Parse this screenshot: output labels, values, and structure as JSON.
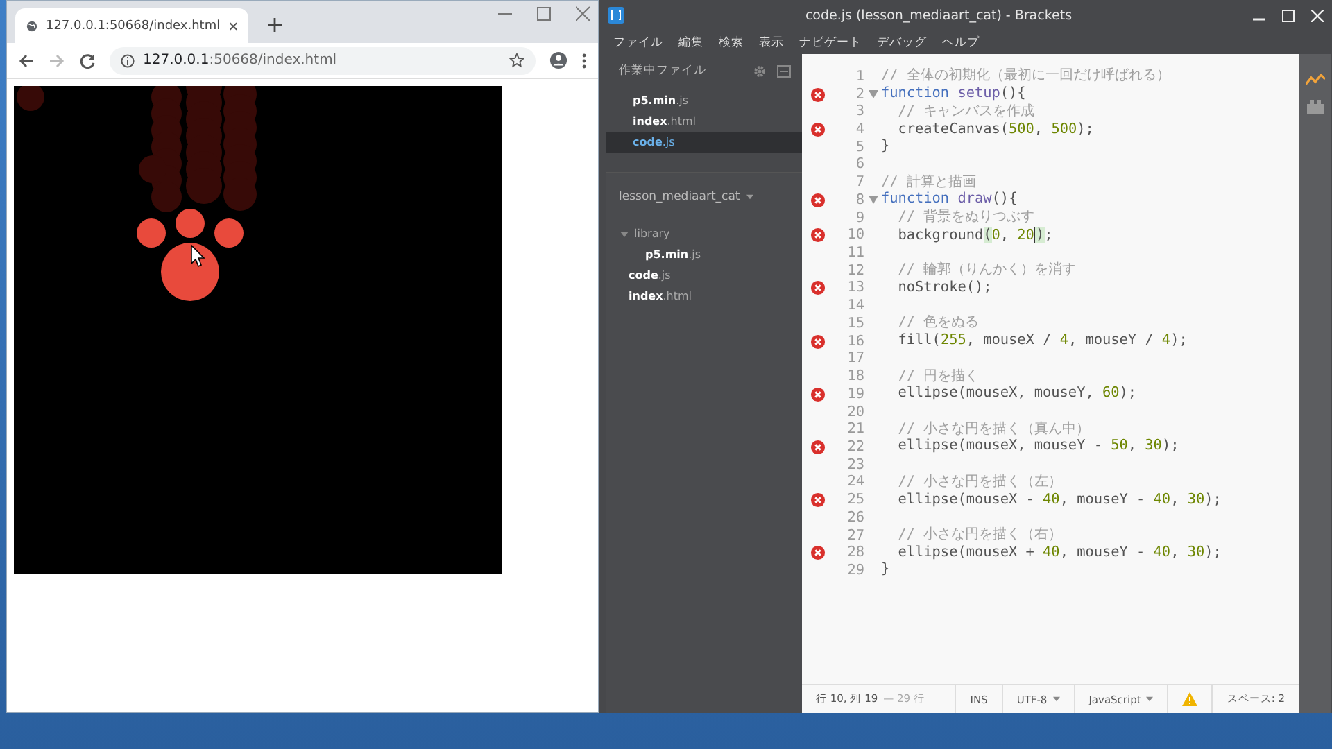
{
  "browser": {
    "tab_title": "127.0.0.1:50668/index.html",
    "address": {
      "host": "127.0.0.1",
      "path": ":50668/index.html"
    }
  },
  "editor": {
    "title": "code.js (lesson_mediaart_cat) - Brackets",
    "menu": [
      "ファイル",
      "編集",
      "検索",
      "表示",
      "ナビゲート",
      "デバッグ",
      "ヘルプ"
    ],
    "working_files": {
      "title": "作業中ファイル",
      "items": [
        {
          "name": "**p5.min**.js",
          "selected": false
        },
        {
          "name": "**index**.html",
          "selected": false
        },
        {
          "name": "**code**.js",
          "selected": true
        }
      ]
    },
    "project": {
      "name": "lesson_mediaart_cat",
      "tree": [
        {
          "kind": "folder",
          "name": "library",
          "expanded": true,
          "children": [
            {
              "kind": "file",
              "name": "**p5.min**.js"
            }
          ]
        },
        {
          "kind": "file",
          "name": "**code**.js"
        },
        {
          "kind": "file",
          "name": "**index**.html"
        }
      ]
    },
    "lines": [
      {
        "n": "1",
        "error": false,
        "fold": false,
        "tokens": [
          {
            "kind": "comment",
            "text": "// 全体の初期化（最初に一回だけ呼ばれる）"
          }
        ]
      },
      {
        "n": "2",
        "error": true,
        "fold": true,
        "tokens": [
          {
            "kind": "keyword",
            "text": "function"
          },
          {
            "kind": "def",
            "text": " setup"
          },
          {
            "kind": "plain",
            "text": "(){"
          }
        ]
      },
      {
        "n": "3",
        "error": false,
        "fold": false,
        "tokens": [
          {
            "kind": "comment",
            "text": "  // キャンバスを作成"
          }
        ]
      },
      {
        "n": "4",
        "error": true,
        "fold": false,
        "tokens": [
          {
            "kind": "plain",
            "text": "  createCanvas("
          },
          {
            "kind": "number",
            "text": "500"
          },
          {
            "kind": "plain",
            "text": ", "
          },
          {
            "kind": "number",
            "text": "500"
          },
          {
            "kind": "plain",
            "text": ");"
          }
        ]
      },
      {
        "n": "5",
        "error": false,
        "fold": false,
        "tokens": [
          {
            "kind": "plain",
            "text": "}"
          }
        ]
      },
      {
        "n": "6",
        "error": false,
        "fold": false
      },
      {
        "n": "7",
        "error": false,
        "fold": false,
        "tokens": [
          {
            "kind": "comment",
            "text": "// 計算と描画"
          }
        ]
      },
      {
        "n": "8",
        "error": true,
        "fold": true,
        "tokens": [
          {
            "kind": "keyword",
            "text": "function"
          },
          {
            "kind": "def",
            "text": " draw"
          },
          {
            "kind": "plain",
            "text": "(){"
          }
        ]
      },
      {
        "n": "9",
        "error": false,
        "fold": false,
        "tokens": [
          {
            "kind": "comment",
            "text": "  // 背景をぬりつぶす"
          }
        ]
      },
      {
        "n": "10",
        "error": true,
        "fold": false,
        "tokens": [
          {
            "kind": "plain",
            "text": "  background"
          },
          {
            "kind": "match",
            "text": "("
          },
          {
            "kind": "number",
            "text": "0"
          },
          {
            "kind": "plain",
            "text": ", "
          },
          {
            "kind": "number",
            "text": "20",
            "cursor": true
          },
          {
            "kind": "match",
            "text": ")"
          },
          {
            "kind": "plain",
            "text": ";"
          }
        ]
      },
      {
        "n": "11",
        "error": false,
        "fold": false
      },
      {
        "n": "12",
        "error": false,
        "fold": false,
        "tokens": [
          {
            "kind": "comment",
            "text": "  // 輪郭（りんかく）を消す"
          }
        ]
      },
      {
        "n": "13",
        "error": true,
        "fold": false,
        "tokens": [
          {
            "kind": "plain",
            "text": "  noStroke();"
          }
        ]
      },
      {
        "n": "14",
        "error": false,
        "fold": false
      },
      {
        "n": "15",
        "error": false,
        "fold": false,
        "tokens": [
          {
            "kind": "comment",
            "text": "  // 色をぬる"
          }
        ]
      },
      {
        "n": "16",
        "error": true,
        "fold": false,
        "tokens": [
          {
            "kind": "plain",
            "text": "  fill("
          },
          {
            "kind": "number",
            "text": "255"
          },
          {
            "kind": "plain",
            "text": ", mouseX / "
          },
          {
            "kind": "number",
            "text": "4"
          },
          {
            "kind": "plain",
            "text": ", mouseY / "
          },
          {
            "kind": "number",
            "text": "4"
          },
          {
            "kind": "plain",
            "text": ");"
          }
        ]
      },
      {
        "n": "17",
        "error": false,
        "fold": false
      },
      {
        "n": "18",
        "error": false,
        "fold": false,
        "tokens": [
          {
            "kind": "comment",
            "text": "  // 円を描く"
          }
        ]
      },
      {
        "n": "19",
        "error": true,
        "fold": false,
        "tokens": [
          {
            "kind": "plain",
            "text": "  ellipse(mouseX, mouseY, "
          },
          {
            "kind": "number",
            "text": "60"
          },
          {
            "kind": "plain",
            "text": ");"
          }
        ]
      },
      {
        "n": "20",
        "error": false,
        "fold": false
      },
      {
        "n": "21",
        "error": false,
        "fold": false,
        "tokens": [
          {
            "kind": "comment",
            "text": "  // 小さな円を描く（真ん中）"
          }
        ]
      },
      {
        "n": "22",
        "error": true,
        "fold": false,
        "tokens": [
          {
            "kind": "plain",
            "text": "  ellipse(mouseX, mouseY - "
          },
          {
            "kind": "number",
            "text": "50"
          },
          {
            "kind": "plain",
            "text": ", "
          },
          {
            "kind": "number",
            "text": "30"
          },
          {
            "kind": "plain",
            "text": ");"
          }
        ]
      },
      {
        "n": "23",
        "error": false,
        "fold": false
      },
      {
        "n": "24",
        "error": false,
        "fold": false,
        "tokens": [
          {
            "kind": "comment",
            "text": "  // 小さな円を描く（左）"
          }
        ]
      },
      {
        "n": "25",
        "error": true,
        "fold": false,
        "tokens": [
          {
            "kind": "plain",
            "text": "  ellipse(mouseX - "
          },
          {
            "kind": "number",
            "text": "40"
          },
          {
            "kind": "plain",
            "text": ", mouseY - "
          },
          {
            "kind": "number",
            "text": "40"
          },
          {
            "kind": "plain",
            "text": ", "
          },
          {
            "kind": "number",
            "text": "30"
          },
          {
            "kind": "plain",
            "text": ");"
          }
        ]
      },
      {
        "n": "26",
        "error": false,
        "fold": false
      },
      {
        "n": "27",
        "error": false,
        "fold": false,
        "tokens": [
          {
            "kind": "comment",
            "text": "  // 小さな円を描く（右）"
          }
        ]
      },
      {
        "n": "28",
        "error": true,
        "fold": false,
        "tokens": [
          {
            "kind": "plain",
            "text": "  ellipse(mouseX + "
          },
          {
            "kind": "number",
            "text": "40"
          },
          {
            "kind": "plain",
            "text": ", mouseY - "
          },
          {
            "kind": "number",
            "text": "40"
          },
          {
            "kind": "plain",
            "text": ", "
          },
          {
            "kind": "number",
            "text": "30"
          },
          {
            "kind": "plain",
            "text": ");"
          }
        ]
      },
      {
        "n": "29",
        "error": false,
        "fold": false,
        "tokens": [
          {
            "kind": "plain",
            "text": "}"
          }
        ]
      }
    ],
    "status": {
      "position": "行 10, 列 19",
      "count": "— 29 行",
      "mode": "INS",
      "encoding": "UTF-8",
      "language": "JavaScript",
      "indent": "スペース: 2"
    }
  }
}
